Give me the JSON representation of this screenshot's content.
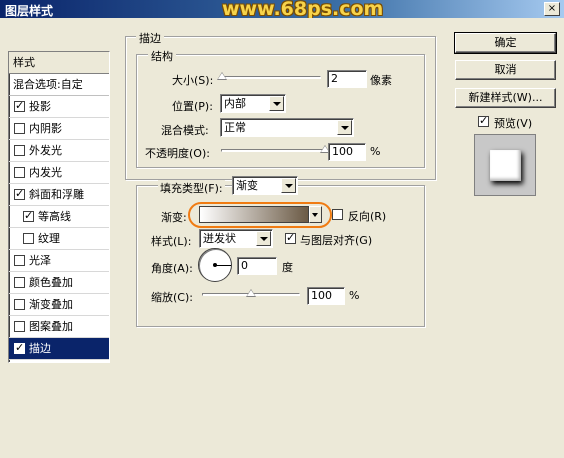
{
  "window": {
    "title": "图层样式",
    "watermark": "www.68ps.com",
    "close_glyph": "×"
  },
  "style_list": {
    "header": "样式",
    "blend_options": "混合选项:自定",
    "items": [
      {
        "label": "投影",
        "checked": true
      },
      {
        "label": "内阴影",
        "checked": false
      },
      {
        "label": "外发光",
        "checked": false
      },
      {
        "label": "内发光",
        "checked": false
      },
      {
        "label": "斜面和浮雕",
        "checked": true
      },
      {
        "label": "等高线",
        "checked": true
      },
      {
        "label": "纹理",
        "checked": false
      },
      {
        "label": "光泽",
        "checked": false
      },
      {
        "label": "颜色叠加",
        "checked": false
      },
      {
        "label": "渐变叠加",
        "checked": false
      },
      {
        "label": "图案叠加",
        "checked": false
      },
      {
        "label": "描边",
        "checked": true
      }
    ]
  },
  "stroke": {
    "section_title": "描边",
    "structure_title": "结构",
    "size_label": "大小(S):",
    "size_value": "2",
    "size_unit": "像素",
    "size_fraction": 0.01,
    "position_label": "位置(P):",
    "position_value": "内部",
    "blend_mode_label": "混合模式:",
    "blend_mode_value": "正常",
    "opacity_label": "不透明度(O):",
    "opacity_value": "100",
    "opacity_unit": "%",
    "opacity_fraction": 1.0
  },
  "fill": {
    "fill_type_label": "填充类型(F):",
    "fill_type_value": "渐变",
    "gradient_label": "渐变:",
    "reverse_label": "反向(R)",
    "reverse_checked": false,
    "style_label": "样式(L):",
    "style_value": "迸发状",
    "align_label": "与图层对齐(G)",
    "align_checked": true,
    "angle_label": "角度(A):",
    "angle_value": "0",
    "angle_unit": "度",
    "scale_label": "缩放(C):",
    "scale_value": "100",
    "scale_unit": "%",
    "scale_fraction": 0.5,
    "gradient_colors": [
      "#ffffff",
      "#6b5a45"
    ]
  },
  "buttons": {
    "ok": "确定",
    "cancel": "取消",
    "new_style": "新建样式(W)...",
    "preview_label": "预览(V)",
    "preview_checked": true
  }
}
